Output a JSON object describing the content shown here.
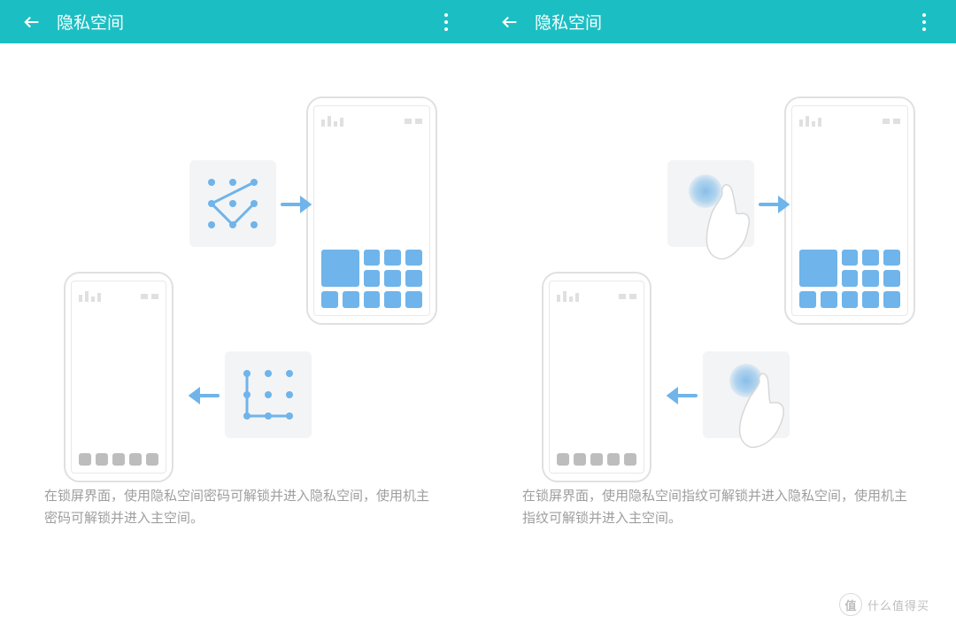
{
  "left": {
    "title": "隐私空间",
    "description": "在锁屏界面，使用隐私空间密码可解锁并进入隐私空间，使用机主密码可解锁并进入主空间。"
  },
  "right": {
    "title": "隐私空间",
    "description": "在锁屏界面，使用隐私空间指纹可解锁并进入隐私空间，使用机主指纹可解锁并进入主空间。"
  },
  "watermark": {
    "symbol": "值",
    "text": "什么值得买"
  }
}
